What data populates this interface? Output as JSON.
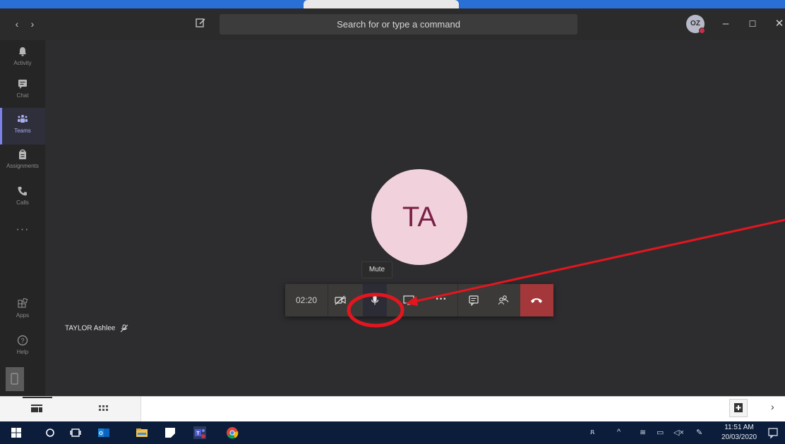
{
  "titlebar": {
    "back": "‹",
    "forward": "›",
    "search_placeholder": "Search for or type a command",
    "avatar_initials": "OZ",
    "minimize": "–",
    "maximize": "☐",
    "close": "✕"
  },
  "rail": {
    "items": [
      {
        "label": "Activity"
      },
      {
        "label": "Chat"
      },
      {
        "label": "Teams"
      },
      {
        "label": "Assignments"
      },
      {
        "label": "Calls"
      }
    ],
    "more": "···",
    "apps_label": "Apps",
    "help_label": "Help"
  },
  "call": {
    "avatar_initials": "TA",
    "participant_name": "TAYLOR Ashlee",
    "tooltip": "Mute",
    "timer": "02:20",
    "more": "···"
  },
  "taskbar": {
    "time": "11:51 AM",
    "date": "20/03/2020"
  },
  "colors": {
    "accent": "#7b83eb",
    "hangup": "#a4373a",
    "annotation": "#e3161e",
    "avatar_bg": "#f1d2dc",
    "avatar_text": "#7a2145"
  }
}
